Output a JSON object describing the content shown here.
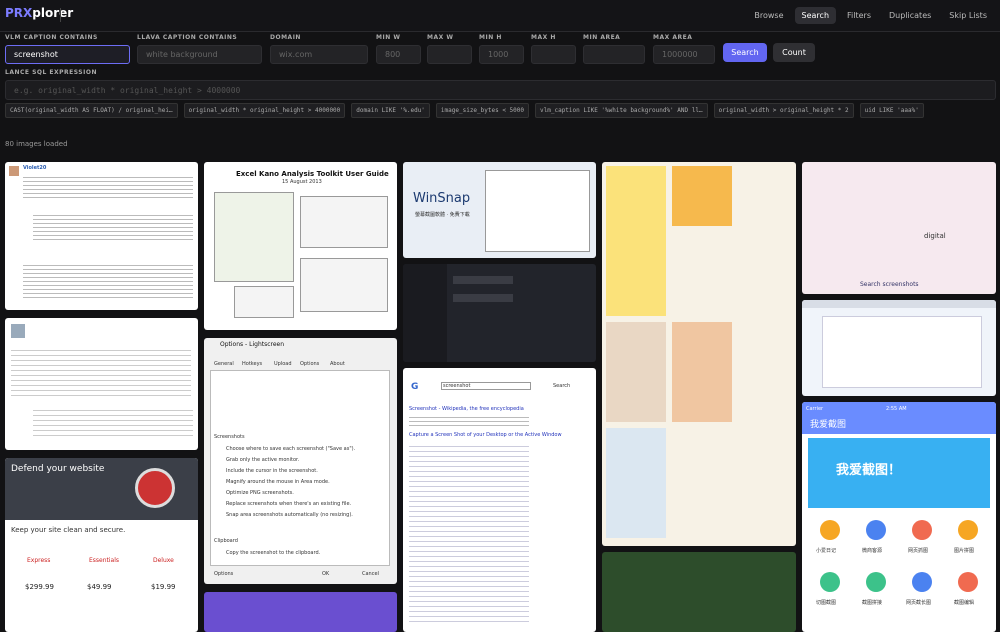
{
  "app": {
    "logo_prefix": "PRX",
    "logo_suffix": "plorer"
  },
  "nav": [
    {
      "label": "Browse",
      "active": false
    },
    {
      "label": "Search",
      "active": true
    },
    {
      "label": "Filters",
      "active": false
    },
    {
      "label": "Duplicates",
      "active": false
    },
    {
      "label": "Skip Lists",
      "active": false
    }
  ],
  "filters": {
    "vlm": {
      "label": "VLM CAPTION CONTAINS",
      "value": "screenshot"
    },
    "llava": {
      "label": "LLAVA CAPTION CONTAINS",
      "placeholder": "white background"
    },
    "domain": {
      "label": "DOMAIN",
      "placeholder": "wix.com"
    },
    "min_w": {
      "label": "MIN W",
      "placeholder": "800"
    },
    "max_w": {
      "label": "MAX W",
      "placeholder": ""
    },
    "min_h": {
      "label": "MIN H",
      "placeholder": "1000"
    },
    "max_h": {
      "label": "MAX H",
      "placeholder": ""
    },
    "min_area": {
      "label": "MIN AREA",
      "placeholder": ""
    },
    "max_area": {
      "label": "MAX AREA",
      "placeholder": "1000000"
    }
  },
  "buttons": {
    "search": "Search",
    "count": "Count"
  },
  "lance": {
    "label": "LANCE SQL EXPRESSION",
    "placeholder": "e.g. original_width * original_height > 4000000"
  },
  "chips": [
    "CAST(original_width AS FLOAT) / original_hei…",
    "original_width * original_height > 4000000",
    "domain LIKE '%.edu'",
    "image_size_bytes < 5000",
    "vlm_caption LIKE '%white background%' AND ll…",
    "original_width > original_height * 2",
    "uid LIKE 'aaa%'"
  ],
  "status": {
    "loaded": "80 images loaded"
  },
  "thumbs": {
    "blog_user": "Violet20",
    "excel_title": "Excel Kano Analysis Toolkit User Guide",
    "excel_date": "15 August 2013",
    "winsnap": "WinSnap",
    "winsnap_sub": "螢幕截圖軟體 · 免費下載",
    "options_title": "Options - Lightscreen",
    "options_tabs": [
      "General",
      "Hotkeys",
      "Upload",
      "Options",
      "About"
    ],
    "options_items": [
      "Choose where to save each screenshot (\"Save as\").",
      "Grab only the active monitor.",
      "Include the cursor in the screenshot.",
      "Magnify around the mouse in Area mode.",
      "Optimize PNG screenshots.",
      "Replace screenshots when there's an existing file.",
      "Snap area screenshots automatically (no resizing)."
    ],
    "options_section_screenshots": "Screenshots",
    "options_section_clipboard": "Clipboard",
    "options_clipboard": "Copy the screenshot to the clipboard.",
    "options_ok": "OK",
    "options_cancel": "Cancel",
    "options_btn": "Options",
    "security_title": "Defend your website",
    "security_sub": "Keep your site clean and secure.",
    "plans": [
      "Express",
      "Essentials",
      "Deluxe"
    ],
    "prices": [
      "$299.99",
      "$49.99",
      "$19.99"
    ],
    "google_query": "screenshot",
    "google_search": "Search",
    "google_result1": "Screenshot - Wikipedia, the free encyclopedia",
    "google_result2": "Capture a Screen Shot of your Desktop or the Active Window",
    "search_screens": "Search screenshots",
    "digital": "digital",
    "carrier": "Carrier",
    "time": "2:55 AM",
    "cn_app": "我爱截图",
    "cn_banner": "我爱截图！",
    "cn_icons": [
      "小爱日记",
      "微商客源",
      "网页抓图",
      "图片拼图",
      "切图截图",
      "截图拼接",
      "网页截长图",
      "截图编辑"
    ]
  }
}
